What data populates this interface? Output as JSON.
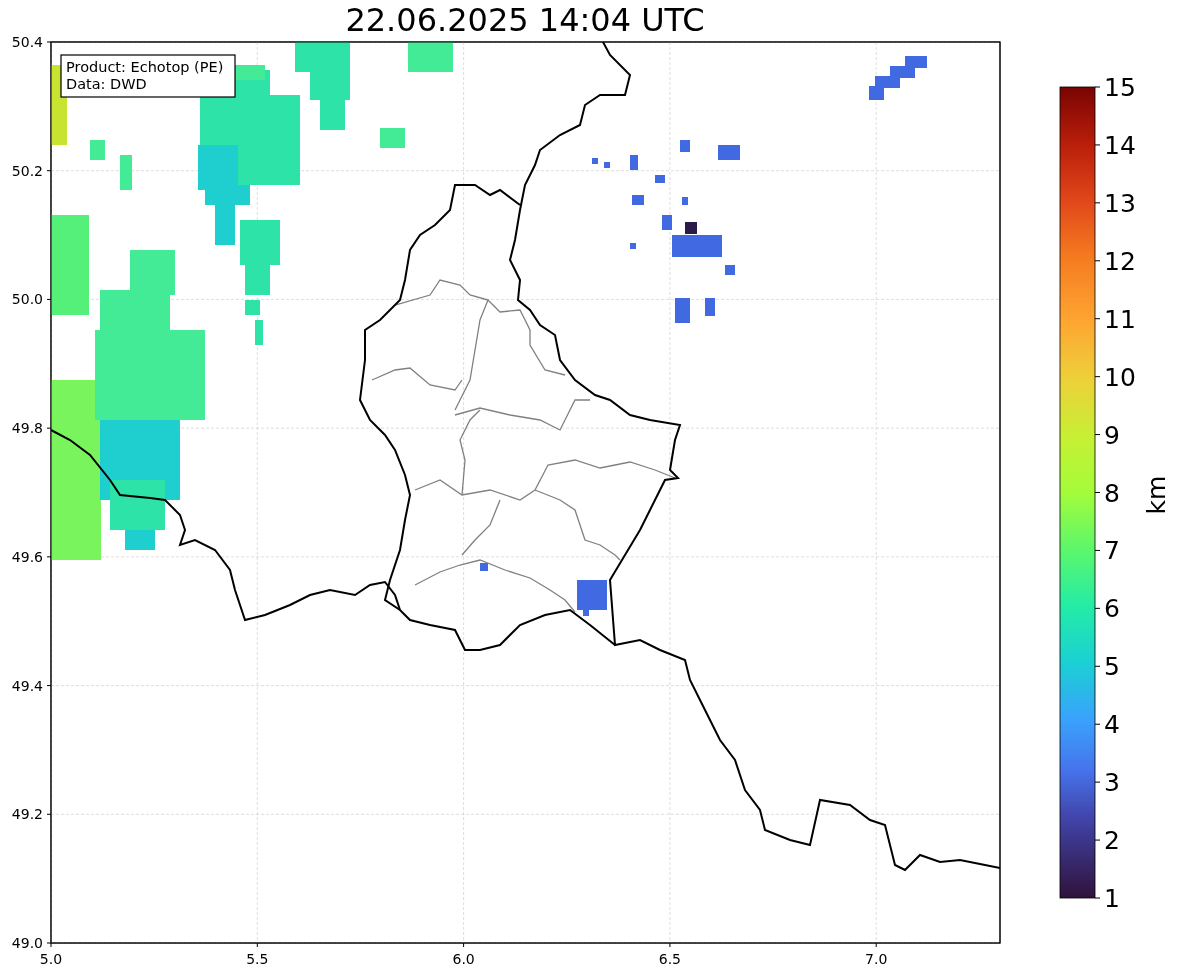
{
  "title": "22.06.2025 14:04 UTC",
  "annotation": [
    "Product: Echotop (PE)",
    "Data: DWD"
  ],
  "map": {
    "xtick_labels": [
      "5.0",
      "5.5",
      "6.0",
      "6.5",
      "7.0"
    ],
    "ytick_labels": [
      "50.4",
      "50.2",
      "50.0",
      "49.8",
      "49.6",
      "49.4",
      "49.2",
      "49.0"
    ]
  },
  "colorbar": {
    "label": "km",
    "tick_labels": [
      "15",
      "14",
      "13",
      "12",
      "11",
      "10",
      "9",
      "8",
      "7",
      "6",
      "5",
      "4",
      "3",
      "2",
      "1"
    ]
  }
}
